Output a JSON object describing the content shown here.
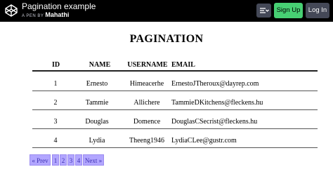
{
  "header": {
    "title": "Pagination example",
    "byline_prefix": "A PEN BY",
    "author": "Mahathi",
    "signup_label": "Sign Up",
    "login_label": "Log In",
    "colors": {
      "bar": "#000000",
      "signup": "#47cf73",
      "button": "#444857"
    }
  },
  "page": {
    "title": "PAGINATION"
  },
  "table": {
    "columns": [
      "ID",
      "NAME",
      "USERNAME",
      "EMAIL"
    ],
    "rows": [
      {
        "id": "1",
        "name": "Ernesto",
        "username": "Himeacerhe",
        "email": "ErnestoJTheroux@dayrep.com"
      },
      {
        "id": "2",
        "name": "Tammie",
        "username": "Allichere",
        "email": "TammieDKitchens@fleckens.hu"
      },
      {
        "id": "3",
        "name": "Douglas",
        "username": "Domence",
        "email": "DouglasCSecrist@fleckens.hu"
      },
      {
        "id": "4",
        "name": "Lydia",
        "username": "Theeng1946",
        "email": "LydiaCLee@gustr.com"
      }
    ]
  },
  "pagination": {
    "prev_label": "« Prev",
    "pages": [
      "1",
      "2",
      "3",
      "4"
    ],
    "next_label": "Next »",
    "color": "#b2a6ff"
  }
}
